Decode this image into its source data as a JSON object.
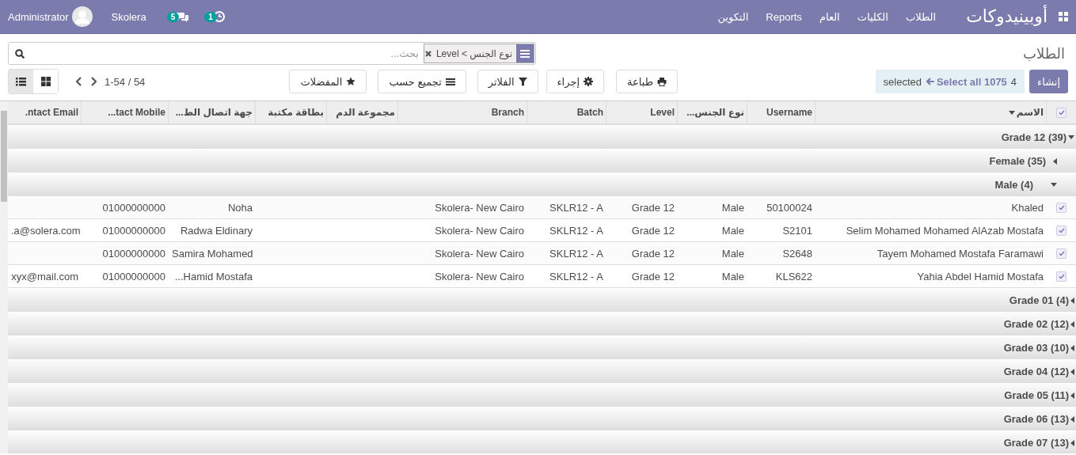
{
  "navbar": {
    "brand": "أوبينيدوكات",
    "menu": [
      {
        "label": "الطلاب"
      },
      {
        "label": "الكليات"
      },
      {
        "label": "العام"
      },
      {
        "label": "Reports"
      },
      {
        "label": "التكوين"
      }
    ],
    "activities_count": "1",
    "messages_count": "5",
    "company": "Skolera",
    "user": "Administrator"
  },
  "control_panel": {
    "breadcrumb": "الطلاب",
    "search": {
      "facet": "نوع الجنس > Level",
      "placeholder": "بحث..."
    },
    "create_button": "إنشاء",
    "selection": {
      "count": "4",
      "select_all": "Select all 1075",
      "suffix": "selected"
    },
    "buttons": [
      {
        "kind": "print",
        "label": "طباعة"
      },
      {
        "kind": "action",
        "label": "إجراء"
      }
    ],
    "search_buttons": [
      {
        "kind": "filter",
        "label": "الفلاتر"
      },
      {
        "kind": "group",
        "label": "تجميع حسب"
      },
      {
        "kind": "favorite",
        "label": "المفضلات"
      }
    ],
    "pager": "54 / 1-54",
    "views": [
      {
        "kind": "list",
        "selected": true
      },
      {
        "kind": "kanban",
        "selected": false
      }
    ]
  },
  "table": {
    "all_checked": true,
    "columns": [
      {
        "label": ".ntact Email",
        "sorted": false
      },
      {
        "label": "...tact Mobile",
        "sorted": false
      },
      {
        "label": "جهة اتصال الط...",
        "sorted": false
      },
      {
        "label": "بطاقة مكتبة",
        "sorted": false
      },
      {
        "label": "مجموعة الدم",
        "sorted": false
      },
      {
        "label": "Branch",
        "sorted": false
      },
      {
        "label": "Batch",
        "sorted": false
      },
      {
        "label": "Level",
        "sorted": false
      },
      {
        "label": "نوع الجنس...",
        "sorted": false
      },
      {
        "label": "Username",
        "sorted": false
      },
      {
        "label": "الاسم",
        "sorted": true
      }
    ],
    "groups": [
      {
        "label": "Grade 12 (39)",
        "expanded": true,
        "children": [
          {
            "label": "Female (35)",
            "expanded": false
          },
          {
            "label": "Male (4)",
            "expanded": true,
            "rows": [
              {
                "selected": true,
                "cells": [
                  null,
                  "01000000000",
                  "Noha",
                  null,
                  null,
                  "Skolera- New Cairo",
                  "SKLR12 - A",
                  "Grade 12",
                  "Male",
                  "50100024",
                  "Khaled"
                ]
              },
              {
                "selected": true,
                "cells": [
                  ".a@solera.com",
                  "01000000000",
                  "Radwa Eldinary",
                  null,
                  null,
                  "Skolera- New Cairo",
                  "SKLR12 - A",
                  "Grade 12",
                  "Male",
                  "S2101",
                  "Selim Mohamed Mohamed AlAzab Mostafa"
                ]
              },
              {
                "selected": true,
                "cells": [
                  null,
                  "01000000000",
                  "Samira Mohamed",
                  null,
                  null,
                  "Skolera- New Cairo",
                  "SKLR12 - A",
                  "Grade 12",
                  "Male",
                  "S2648",
                  "Tayem Mohamed Mostafa Faramawi"
                ]
              },
              {
                "selected": true,
                "cells": [
                  "xyx@mail.com",
                  "01000000000",
                  "...Hamid Mostafa",
                  null,
                  null,
                  "Skolera- New Cairo",
                  "SKLR12 - A",
                  "Grade 12",
                  "Male",
                  "KLS622",
                  "Yahia Abdel Hamid Mostafa"
                ]
              }
            ]
          }
        ]
      },
      {
        "label": "Grade 01 (4)",
        "expanded": false
      },
      {
        "label": "Grade 02 (12)",
        "expanded": false
      },
      {
        "label": "Grade 03 (10)",
        "expanded": false
      },
      {
        "label": "Grade 04 (12)",
        "expanded": false
      },
      {
        "label": "Grade 05 (11)",
        "expanded": false
      },
      {
        "label": "Grade 06 (13)",
        "expanded": false
      },
      {
        "label": "Grade 07 (13)",
        "expanded": false
      }
    ]
  }
}
